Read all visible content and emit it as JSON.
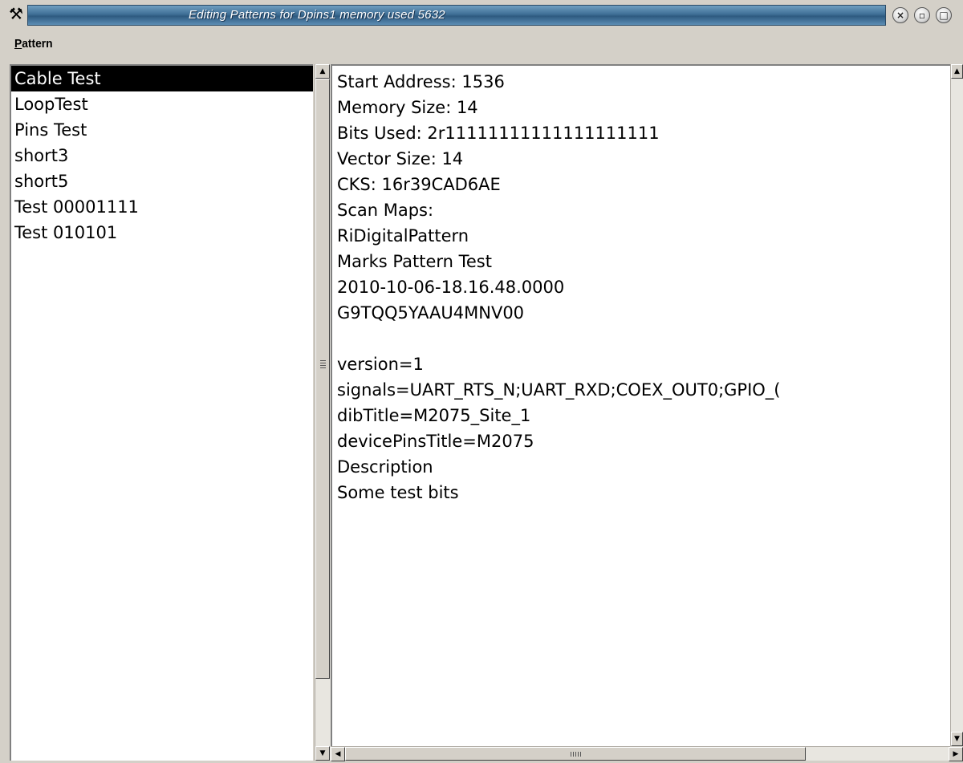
{
  "window": {
    "title": "Editing Patterns for Dpins1 memory used 5632",
    "app_icon": "tools-icon",
    "controls": {
      "close": "×",
      "minimize": "▫",
      "maximize": "□"
    }
  },
  "menubar": {
    "items": [
      {
        "label_underlined": "P",
        "label_rest": "attern"
      }
    ]
  },
  "pattern_list": {
    "selected_index": 0,
    "items": [
      "Cable Test",
      "LoopTest",
      "Pins Test",
      "short3",
      "short5",
      "Test 00001111",
      "Test 010101"
    ]
  },
  "details": {
    "lines": [
      "Start Address: 1536",
      "Memory Size: 14",
      "Bits Used: 2r11111111111111111111",
      "Vector Size: 14",
      "CKS: 16r39CAD6AE",
      "Scan Maps:",
      "RiDigitalPattern",
      "Marks Pattern Test",
      "2010-10-06-18.16.48.0000",
      "G9TQQ5YAAU4MNV00",
      "",
      "version=1",
      "signals=UART_RTS_N;UART_RXD;COEX_OUT0;GPIO_(",
      "dibTitle=M2075_Site_1",
      "devicePinsTitle=M2075",
      "Description",
      "Some test bits"
    ]
  },
  "scrollbars": {
    "up_arrow": "▲",
    "down_arrow": "▼",
    "left_arrow": "◀",
    "right_arrow": "▶"
  }
}
